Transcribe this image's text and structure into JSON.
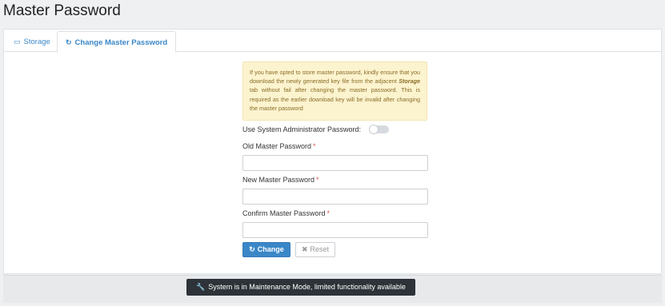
{
  "page": {
    "title": "Master Password"
  },
  "tabs": [
    {
      "label": "Storage",
      "icon": "storage-icon",
      "glyph": "▭"
    },
    {
      "label": "Change Master Password",
      "icon": "refresh-icon",
      "glyph": "↻",
      "active": true
    }
  ],
  "alert": {
    "text_before": "If you have opted to store master password, kindly ensure that you download the newly generated key file from the adjacent ",
    "emphasis": "Storage",
    "text_after": " tab without fail after changing the master password. This is required as the earlier download key will be invalid after changing the master password"
  },
  "form": {
    "sys_admin_label": "Use System Administrator Password:",
    "sys_admin_enabled": false,
    "required_mark": "*",
    "old_label": "Old Master Password",
    "old_value": "",
    "new_label": "New Master Password",
    "new_value": "",
    "confirm_label": "Confirm Master Password",
    "confirm_value": ""
  },
  "buttons": {
    "change_label": "Change",
    "change_glyph": "↻",
    "reset_label": "Reset",
    "reset_glyph": "✖"
  },
  "footer": {
    "maintenance_glyph": "🔧",
    "maintenance_text": "System is in Maintenance Mode, limited functionality available"
  },
  "colors": {
    "accent": "#3a87c8",
    "alert_bg": "#fcf3cf",
    "alert_text": "#8a6d24",
    "required": "#d9534f",
    "maintenance_bg": "#2d3338"
  }
}
